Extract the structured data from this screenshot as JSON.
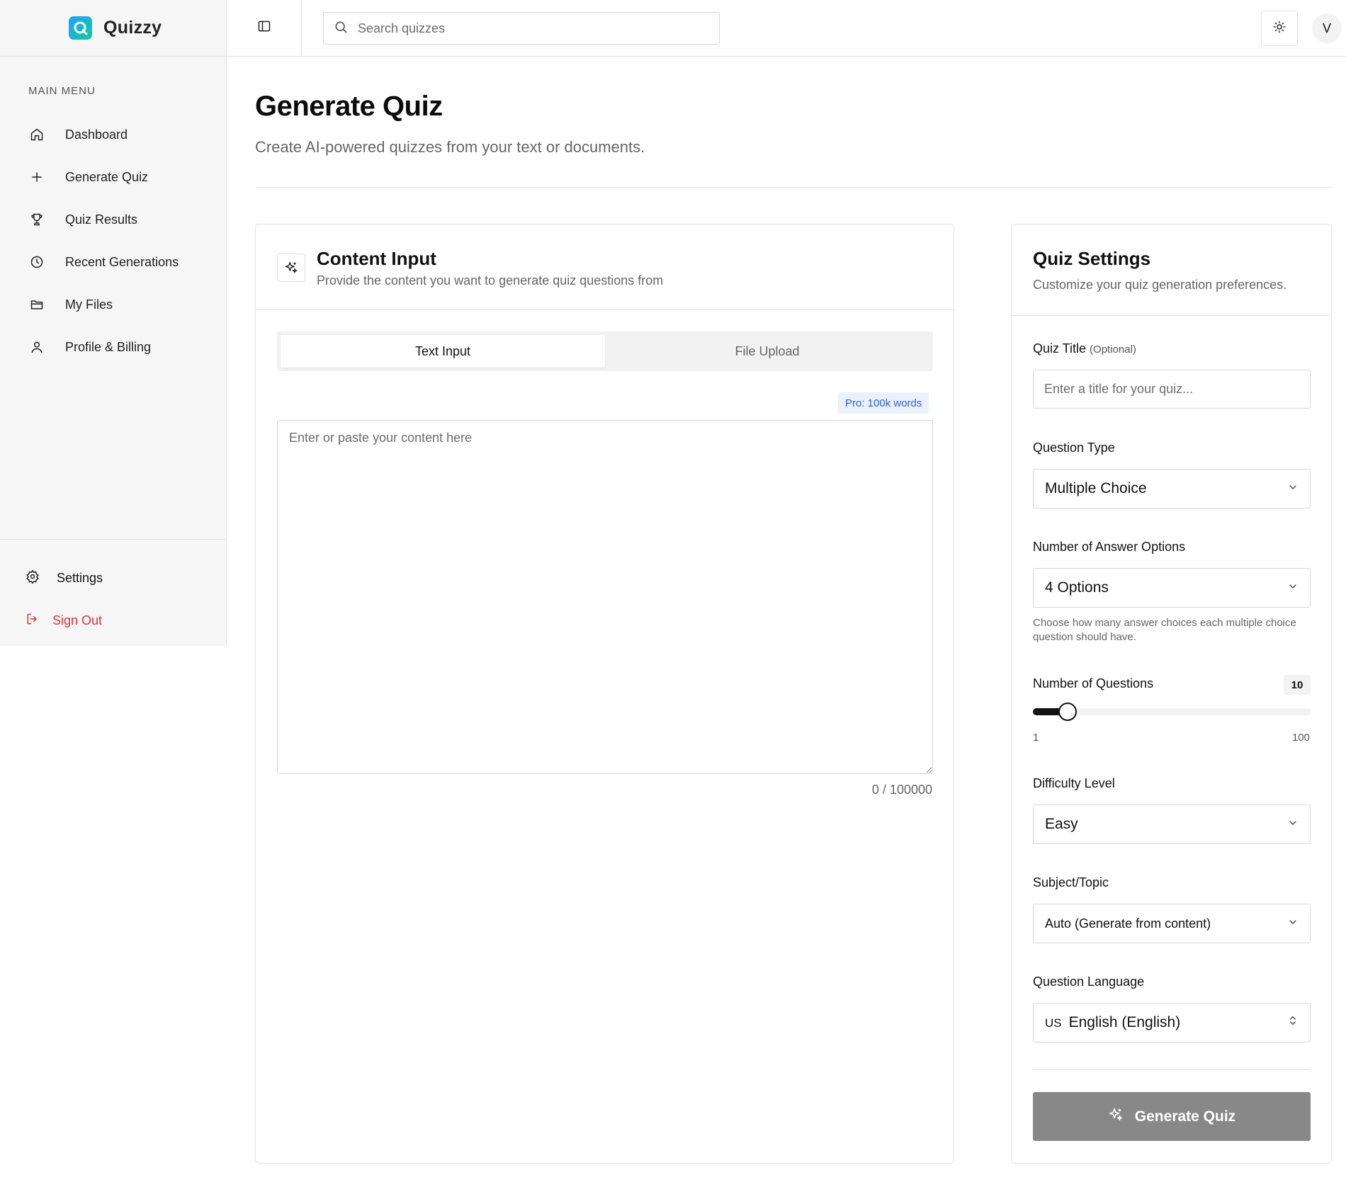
{
  "brand": {
    "name": "Quizzy",
    "logo_letter": "Q"
  },
  "sidebar": {
    "heading": "MAIN MENU",
    "items": [
      {
        "label": "Dashboard",
        "icon": "home-icon"
      },
      {
        "label": "Generate Quiz",
        "icon": "plus-icon"
      },
      {
        "label": "Quiz Results",
        "icon": "trophy-icon"
      },
      {
        "label": "Recent Generations",
        "icon": "clock-icon"
      },
      {
        "label": "My Files",
        "icon": "folder-icon"
      },
      {
        "label": "Profile & Billing",
        "icon": "user-icon"
      }
    ],
    "settings_label": "Settings",
    "signout_label": "Sign Out"
  },
  "topbar": {
    "search_placeholder": "Search quizzes",
    "avatar_initial": "V"
  },
  "page": {
    "title": "Generate Quiz",
    "subtitle": "Create AI-powered quizzes from your text or documents."
  },
  "content_input": {
    "title": "Content Input",
    "subtitle": "Provide the content you want to generate quiz questions from",
    "tabs": [
      "Text Input",
      "File Upload"
    ],
    "active_tab": "Text Input",
    "pro_badge": "Pro: 100k words",
    "textarea_placeholder": "Enter or paste your content here",
    "counter": "0 / 100000"
  },
  "quiz_settings": {
    "title": "Quiz Settings",
    "subtitle": "Customize your quiz generation preferences.",
    "quiz_title_label": "Quiz Title",
    "quiz_title_optional": "(Optional)",
    "quiz_title_placeholder": "Enter a title for your quiz...",
    "question_type_label": "Question Type",
    "question_type_value": "Multiple Choice",
    "answer_options_label": "Number of Answer Options",
    "answer_options_value": "4 Options",
    "answer_options_help": "Choose how many answer choices each multiple choice question should have.",
    "num_questions_label": "Number of Questions",
    "num_questions_value": "10",
    "num_questions_min": "1",
    "num_questions_max": "100",
    "difficulty_label": "Difficulty Level",
    "difficulty_value": "Easy",
    "subject_label": "Subject/Topic",
    "subject_value": "Auto (Generate from content)",
    "language_label": "Question Language",
    "language_flag": "US",
    "language_value": "English (English)",
    "generate_label": "Generate Quiz"
  },
  "colors": {
    "accent_disabled": "#888888",
    "signout": "#e0303a",
    "pro_badge_bg": "#eaf1fd",
    "pro_badge_text": "#2f62d8"
  }
}
